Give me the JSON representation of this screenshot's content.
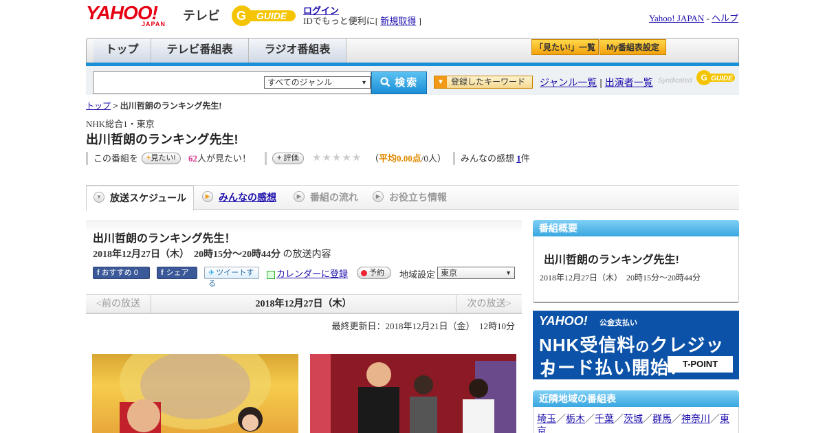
{
  "header": {
    "yahoo_logo": "YAHOO!",
    "yahoo_japan": "JAPAN",
    "tv_label": "テレビ",
    "gguide_logo": "G-GUIDE",
    "login": "ログイン",
    "id_text_pre": "IDでもっと便利に[",
    "register": "新規取得",
    "id_text_post": "]",
    "yahoo_japan_link": "Yahoo! JAPAN",
    "separator": "-",
    "help": "ヘルプ"
  },
  "nav": {
    "tabs": [
      "トップ",
      "テレビ番組表",
      "ラジオ番組表"
    ],
    "buttons": [
      "「見たい!」一覧",
      "My番組表設定"
    ]
  },
  "search": {
    "input_value": "",
    "genre": "すべてのジャンル",
    "search_button": "検索",
    "keyword_button": "登録したキーワード",
    "genre_list": "ジャンル一覧",
    "pipe": "|",
    "performer_list": "出演者一覧",
    "syndicated": "Syndicated"
  },
  "breadcrumb": {
    "home": "トップ",
    "sep": ">",
    "current": "出川哲朗のランキング先生!"
  },
  "program": {
    "channel": "NHK総合1・東京",
    "title": "出川哲朗のランキング先生!",
    "want_pre": "この番組を",
    "want_button": "見たい!",
    "want_count": "62",
    "want_post": "人が見たい！",
    "rate_button": "評価",
    "stars": "★★★★★",
    "avg_pre": "（",
    "avg_label": "平均0.00点",
    "avg_post": "/0人）",
    "impressions_pre": "みんなの感想",
    "impressions_count": "1",
    "impressions_post": "件"
  },
  "tabs": [
    "放送スケジュール",
    "みんなの感想",
    "番組の流れ",
    "お役立ち情報"
  ],
  "schedule": {
    "title": "出川哲朗のランキング先生！",
    "date": "2018年12月27日（木）　20時15分～20時44分",
    "date_suffix": "の放送内容",
    "fb_recommend": "おすすめ 0",
    "fb_share": "シェア",
    "tweet": "ツイートする",
    "calendar": "カレンダーに登録",
    "reserve": "予約",
    "region_label": "地域設定",
    "region_value": "東京",
    "prev": "<前の放送",
    "current_date": "2018年12月27日（木）",
    "next": "次の放送>",
    "updated": "最終更新日：2018年12月21日（金）　12時10分"
  },
  "sidebar": {
    "overview_header": "番組概要",
    "overview_title": "出川哲朗のランキング先生!",
    "overview_date": "2018年12月27日（木）　20時15分～20時44分",
    "ad_yahoo": "YAHOO!",
    "ad_pay": "公金支払い",
    "ad_line1_a": "NHK受信料",
    "ad_line1_b": "の",
    "ad_line1_c": "クレジット",
    "ad_line2": "カード払い開始！",
    "ad_tpoint": "T-POINT",
    "nearby_header": "近隣地域の番組表",
    "nearby": [
      "埼玉",
      "栃木",
      "千葉",
      "茨城",
      "群馬",
      "神奈川",
      "東京"
    ],
    "nearby_sep": "／"
  },
  "colors": {
    "accent_blue": "#1a8ed6",
    "yahoo_red": "#e60012",
    "gguide_yellow": "#f5c400",
    "link": "#1a0dab"
  }
}
